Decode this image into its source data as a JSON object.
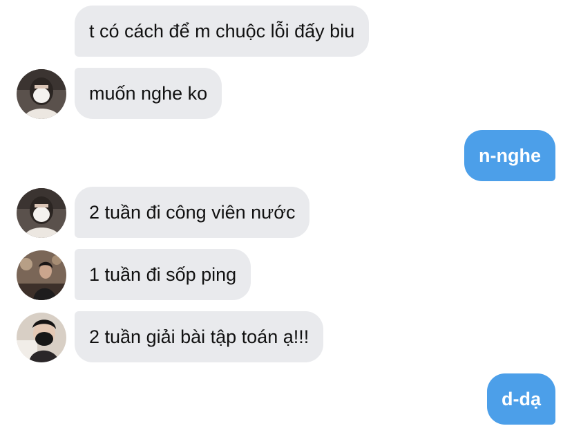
{
  "messages": [
    {
      "text": "t có cách để m chuộc lỗi đấy biu"
    },
    {
      "text": "muốn nghe ko"
    },
    {
      "text": "n-nghe"
    },
    {
      "text": "2 tuần đi công viên nước"
    },
    {
      "text": "1 tuần đi sốp ping"
    },
    {
      "text": "2 tuần giải bài tập toán ạ!!!"
    },
    {
      "text": "d-dạ"
    }
  ],
  "colors": {
    "incoming_bubble": "#e9eaed",
    "outgoing_bubble": "#4c9fe9",
    "incoming_text": "#111111",
    "outgoing_text": "#ffffff"
  },
  "avatars": [
    {
      "icon": "avatar-masked-person-photo"
    },
    {
      "icon": "avatar-masked-person-photo"
    },
    {
      "icon": "avatar-person-photo"
    },
    {
      "icon": "avatar-masked-person-photo"
    }
  ]
}
